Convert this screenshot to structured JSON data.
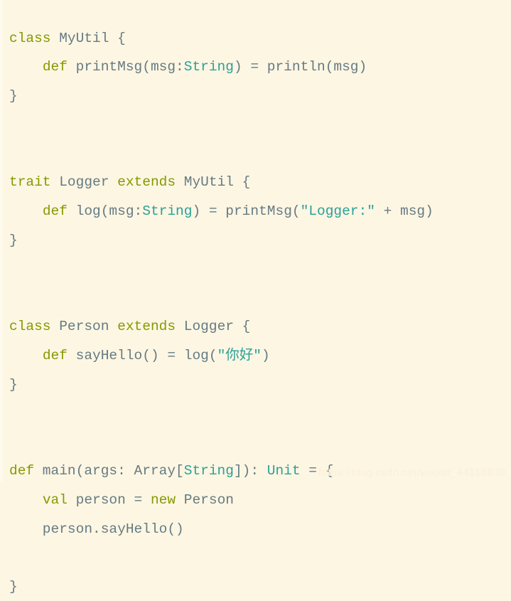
{
  "editor": {
    "language": "Scala",
    "background_color": "#fdf6e3",
    "keyword_color": "#859900",
    "identifier_color": "#657b83",
    "type_color": "#2aa198",
    "string_color": "#2aa198"
  },
  "code": {
    "lines": [
      {
        "index": 0,
        "text": "class MyUtil {",
        "tokens": [
          {
            "t": "class",
            "c": "kw"
          },
          {
            "t": " ",
            "c": "plain"
          },
          {
            "t": "MyUtil",
            "c": "plain"
          },
          {
            "t": " {",
            "c": "brace"
          }
        ]
      },
      {
        "index": 1,
        "text": "    def printMsg(msg:String) = println(msg)",
        "tokens": [
          {
            "t": "    ",
            "c": "plain"
          },
          {
            "t": "def",
            "c": "kw"
          },
          {
            "t": " printMsg(msg:",
            "c": "plain"
          },
          {
            "t": "String",
            "c": "type"
          },
          {
            "t": ") = println(msg)",
            "c": "plain"
          }
        ]
      },
      {
        "index": 2,
        "text": "}",
        "tokens": [
          {
            "t": "}",
            "c": "brace"
          }
        ]
      },
      {
        "index": 3,
        "text": "",
        "tokens": []
      },
      {
        "index": 4,
        "text": "",
        "tokens": []
      },
      {
        "index": 5,
        "text": "trait Logger extends MyUtil {",
        "tokens": [
          {
            "t": "trait",
            "c": "kw"
          },
          {
            "t": " Logger ",
            "c": "plain"
          },
          {
            "t": "extends",
            "c": "kw"
          },
          {
            "t": " MyUtil {",
            "c": "plain"
          }
        ]
      },
      {
        "index": 6,
        "text": "    def log(msg:String) = printMsg(\"Logger:\" + msg)",
        "tokens": [
          {
            "t": "    ",
            "c": "plain"
          },
          {
            "t": "def",
            "c": "kw"
          },
          {
            "t": " log(msg:",
            "c": "plain"
          },
          {
            "t": "String",
            "c": "type"
          },
          {
            "t": ") = printMsg(",
            "c": "plain"
          },
          {
            "t": "\"Logger:\"",
            "c": "str"
          },
          {
            "t": " + msg)",
            "c": "plain"
          }
        ]
      },
      {
        "index": 7,
        "text": "}",
        "tokens": [
          {
            "t": "}",
            "c": "brace"
          }
        ]
      },
      {
        "index": 8,
        "text": "",
        "tokens": []
      },
      {
        "index": 9,
        "text": "",
        "tokens": []
      },
      {
        "index": 10,
        "text": "class Person extends Logger {",
        "tokens": [
          {
            "t": "class",
            "c": "kw"
          },
          {
            "t": " Person ",
            "c": "plain"
          },
          {
            "t": "extends",
            "c": "kw"
          },
          {
            "t": " Logger {",
            "c": "plain"
          }
        ]
      },
      {
        "index": 11,
        "text": "    def sayHello() = log(\"你好\")",
        "tokens": [
          {
            "t": "    ",
            "c": "plain"
          },
          {
            "t": "def",
            "c": "kw"
          },
          {
            "t": " sayHello() = log(",
            "c": "plain"
          },
          {
            "t": "\"你好\"",
            "c": "str"
          },
          {
            "t": ")",
            "c": "plain"
          }
        ]
      },
      {
        "index": 12,
        "text": "}",
        "tokens": [
          {
            "t": "}",
            "c": "brace"
          }
        ]
      },
      {
        "index": 13,
        "text": "",
        "tokens": []
      },
      {
        "index": 14,
        "text": "",
        "tokens": []
      },
      {
        "index": 15,
        "text": "def main(args: Array[String]): Unit = {",
        "tokens": [
          {
            "t": "def",
            "c": "kw"
          },
          {
            "t": " main(args: Array[",
            "c": "plain"
          },
          {
            "t": "String",
            "c": "type"
          },
          {
            "t": "]): ",
            "c": "plain"
          },
          {
            "t": "Unit",
            "c": "type"
          },
          {
            "t": " = {",
            "c": "plain"
          }
        ]
      },
      {
        "index": 16,
        "text": "    val person = new Person",
        "tokens": [
          {
            "t": "    ",
            "c": "plain"
          },
          {
            "t": "val",
            "c": "kw"
          },
          {
            "t": " person = ",
            "c": "plain"
          },
          {
            "t": "new",
            "c": "kw"
          },
          {
            "t": " Person",
            "c": "plain"
          }
        ]
      },
      {
        "index": 17,
        "text": "    person.sayHello()",
        "tokens": [
          {
            "t": "    person.sayHello()",
            "c": "plain"
          }
        ]
      },
      {
        "index": 18,
        "text": "",
        "tokens": []
      },
      {
        "index": 19,
        "text": "}",
        "tokens": [
          {
            "t": "}",
            "c": "brace"
          }
        ]
      }
    ]
  },
  "watermark": {
    "text": "https://blog.csdn.net/weixin_44318830"
  }
}
